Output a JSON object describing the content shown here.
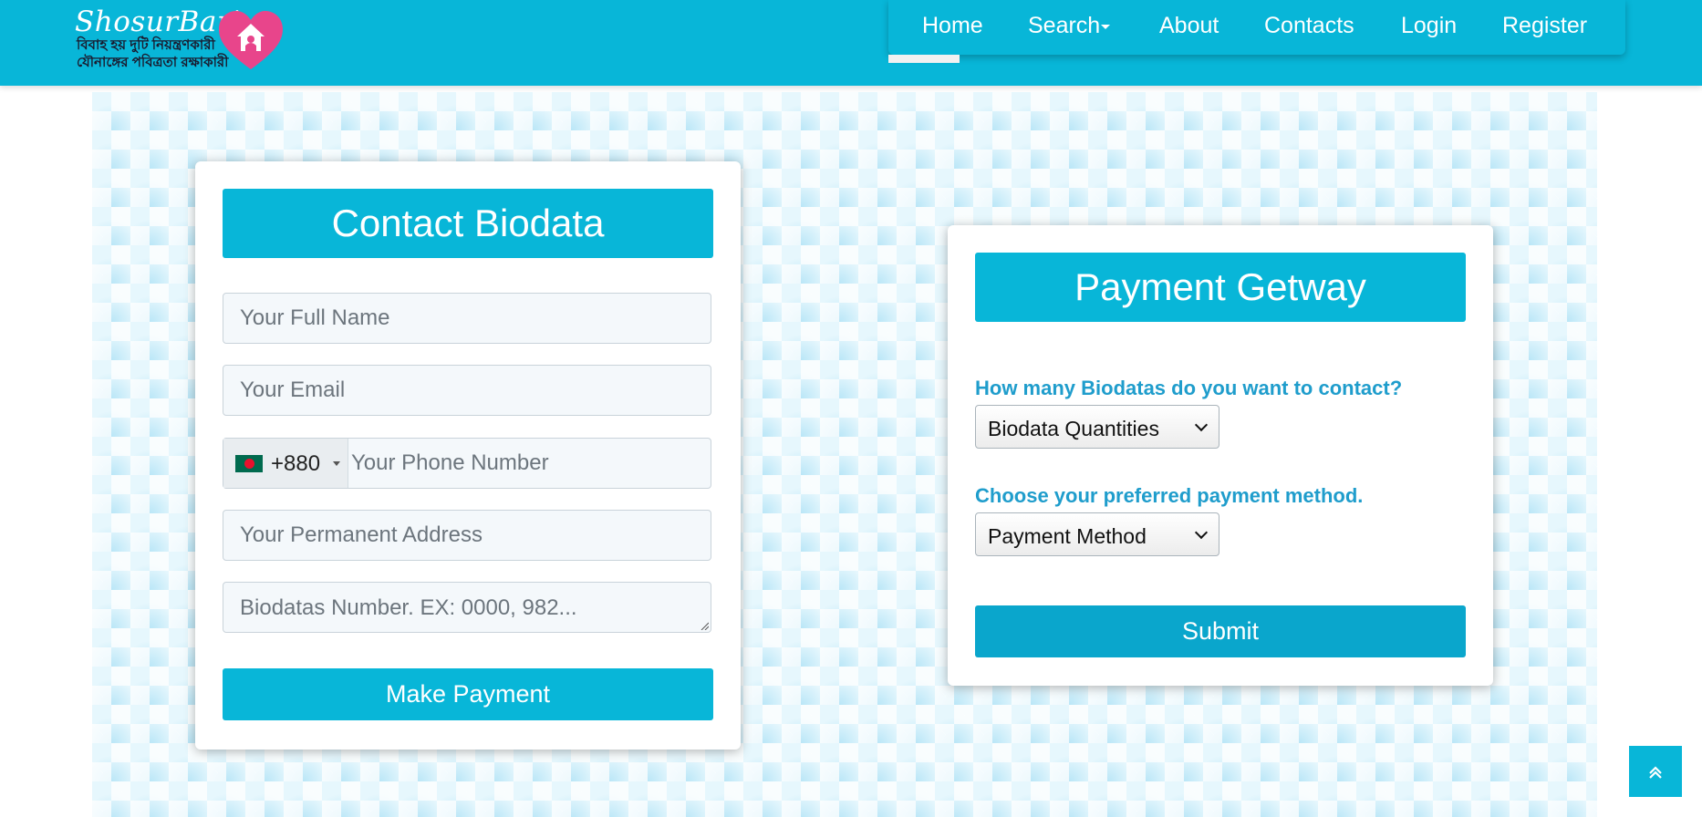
{
  "header": {
    "brand": "ShosurBari",
    "tagline_line1": "বিবাহ হয় দুটি নিয়ন্ত্রণকারী",
    "tagline_line2": "যৌনাঙ্গের পবিত্রতা রক্ষাকারী",
    "logo_icon": "heart-house-icon",
    "nav": [
      {
        "label": "Home",
        "active": true
      },
      {
        "label": "Search",
        "dropdown": true
      },
      {
        "label": "About"
      },
      {
        "label": "Contacts"
      },
      {
        "label": "Login"
      },
      {
        "label": "Register"
      }
    ]
  },
  "contact_form": {
    "title": "Contact Biodata",
    "full_name_placeholder": "Your Full Name",
    "email_placeholder": "Your Email",
    "country_flag": "bangladesh-flag-icon",
    "dial_code": "+880",
    "phone_placeholder": "Your Phone Number",
    "address_placeholder": "Your Permanent Address",
    "biodatas_placeholder": "Biodatas Number. EX: 0000, 982...",
    "submit_label": "Make Payment"
  },
  "payment_form": {
    "title": "Payment Getway",
    "quantity_question": "How many Biodatas do you want to contact?",
    "quantity_selected": "Biodata Quantities",
    "method_question": "Choose your preferred payment method.",
    "method_selected": "Payment Method",
    "submit_label": "Submit"
  },
  "scroll_top_icon": "double-chevron-up-icon",
  "colors": {
    "primary": "#08b6d8",
    "submit": "#0aa6cc",
    "label": "#1f9dcc",
    "heart": "#e8458b"
  }
}
